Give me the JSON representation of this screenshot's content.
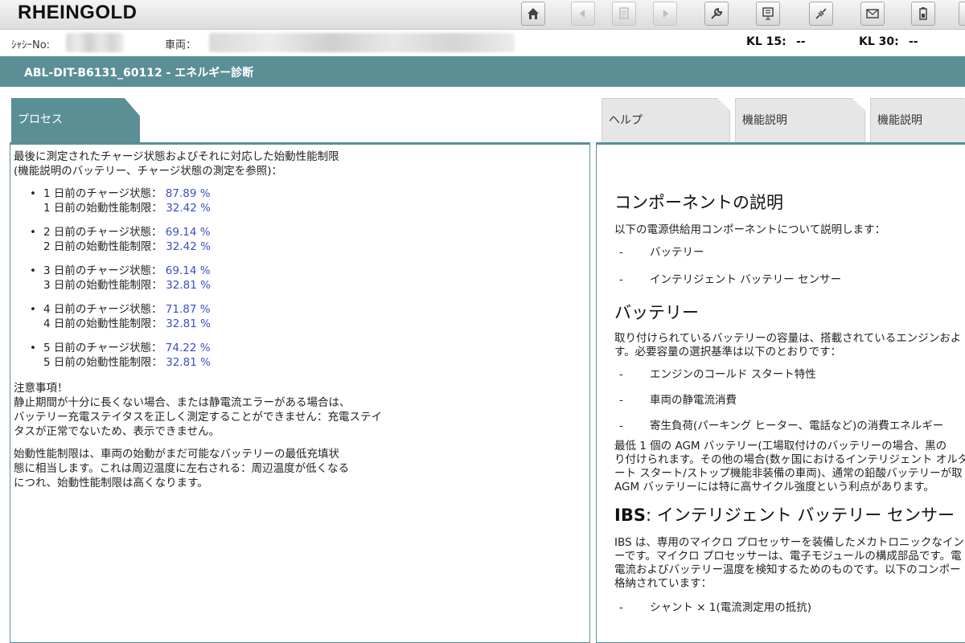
{
  "app": {
    "title": "RHEINGOLD"
  },
  "toolbar": {
    "buttons": [
      {
        "icon": "home-icon",
        "enabled": true
      },
      {
        "icon": "back-icon",
        "enabled": false
      },
      {
        "icon": "document-icon",
        "enabled": false
      },
      {
        "icon": "forward-icon",
        "enabled": false
      },
      {
        "icon": "wrench-icon",
        "enabled": true
      },
      {
        "icon": "vehicle-data-icon",
        "enabled": true
      },
      {
        "icon": "connection-icon",
        "enabled": true
      },
      {
        "icon": "mail-icon",
        "enabled": true
      },
      {
        "icon": "battery-icon",
        "enabled": true
      }
    ]
  },
  "vehicle": {
    "chassis_label": "ｼｬｼｰNo:",
    "vehicle_label": "車両：",
    "kl15_label": "KL 15:",
    "kl15_value": "--",
    "kl30_label": "KL 30:",
    "kl30_value": "--"
  },
  "titlebar": {
    "text": "ABL-DIT-B6131_60112  -  エネルギー診断"
  },
  "tabs": {
    "process": "プロセス",
    "help": "ヘルプ",
    "function1": "機能説明",
    "function2": "機能説明"
  },
  "process": {
    "intro": "最後に測定されたチャージ状態およびそれに対応した始動性能制限",
    "intro2": "(機能説明のバッテリー、チャージ状態の測定を参照)：",
    "bullet": "•",
    "entries": [
      {
        "charge_label": "1 日前のチャージ状態：",
        "charge_value": "87.89 %",
        "limit_label": "1 日前の始動性能制限：",
        "limit_value": "32.42 %"
      },
      {
        "charge_label": "2 日前のチャージ状態：",
        "charge_value": "69.14 %",
        "limit_label": "2 日前の始動性能制限：",
        "limit_value": "32.42 %"
      },
      {
        "charge_label": "3 日前のチャージ状態：",
        "charge_value": "69.14 %",
        "limit_label": "3 日前の始動性能制限：",
        "limit_value": "32.81 %"
      },
      {
        "charge_label": "4 日前のチャージ状態：",
        "charge_value": "71.87 %",
        "limit_label": "4 日前の始動性能制限：",
        "limit_value": "32.81 %"
      },
      {
        "charge_label": "5 日前のチャージ状態：",
        "charge_value": "74.22 %",
        "limit_label": "5 日前の始動性能制限：",
        "limit_value": "32.81 %"
      }
    ],
    "note_title": "注意事項！",
    "note_line1": "静止期間が十分に長くない場合、または静電流エラーがある場合は、",
    "note_line2": "バッテリー充電ステイタスを正しく測定することができません：充電ステイ",
    "note_line3": "タスが正常でないため、表示できません。",
    "note2_line1": "始動性能制限は、車両の始動がまだ可能なバッテリーの最低充填状",
    "note2_line2": "態に相当します。これは周辺温度に左右される：周辺温度が低くなる",
    "note2_line3": "につれ、始動性能制限は高くなります。"
  },
  "description": {
    "dash": "-",
    "heading1": "コンポーネントの説明",
    "intro": "以下の電源供給用コンポーネントについて説明します：",
    "components": [
      "バッテリー",
      "インテリジェント バッテリー センサー"
    ],
    "heading2": "バッテリー",
    "battery_p1": "取り付けられているバッテリーの容量は、搭載されているエンジンおよ",
    "battery_p2": "す。必要容量の選択基準は以下のとおりです：",
    "criteria": [
      "エンジンのコールド スタート特性",
      "車両の静電流消費",
      "寄生負荷(パーキング ヒーター、電話など)の消費エネルギー"
    ],
    "agm_l1": "最低 1 個の AGM バッテリー(工場取付けのバッテリーの場合、黒の",
    "agm_l2": "り付けられます。その他の場合(数ヶ国におけるインテリジェント オルタ",
    "agm_l3": "ート スタート/ストップ機能非装備の車両)、通常の鉛酸バッテリーが取",
    "agm_l4": "AGM バッテリーには特に高サイクル強度という利点があります。",
    "heading3_bold": "IBS",
    "heading3_rest": ": インテリジェント バッテリー センサー",
    "ibs_l1": "IBS は、専用のマイクロ プロセッサーを装備したメカトロニックなインテ",
    "ibs_l2": "ーです。マイクロ プロセッサーは、電子モジュールの構成部品です。電",
    "ibs_l3": "電流およびバッテリー温度を検知するためのものです。以下のコンポー",
    "ibs_l4": "格納されています：",
    "ibs_items": [
      "シャント × 1(電流測定用の抵抗)"
    ]
  }
}
